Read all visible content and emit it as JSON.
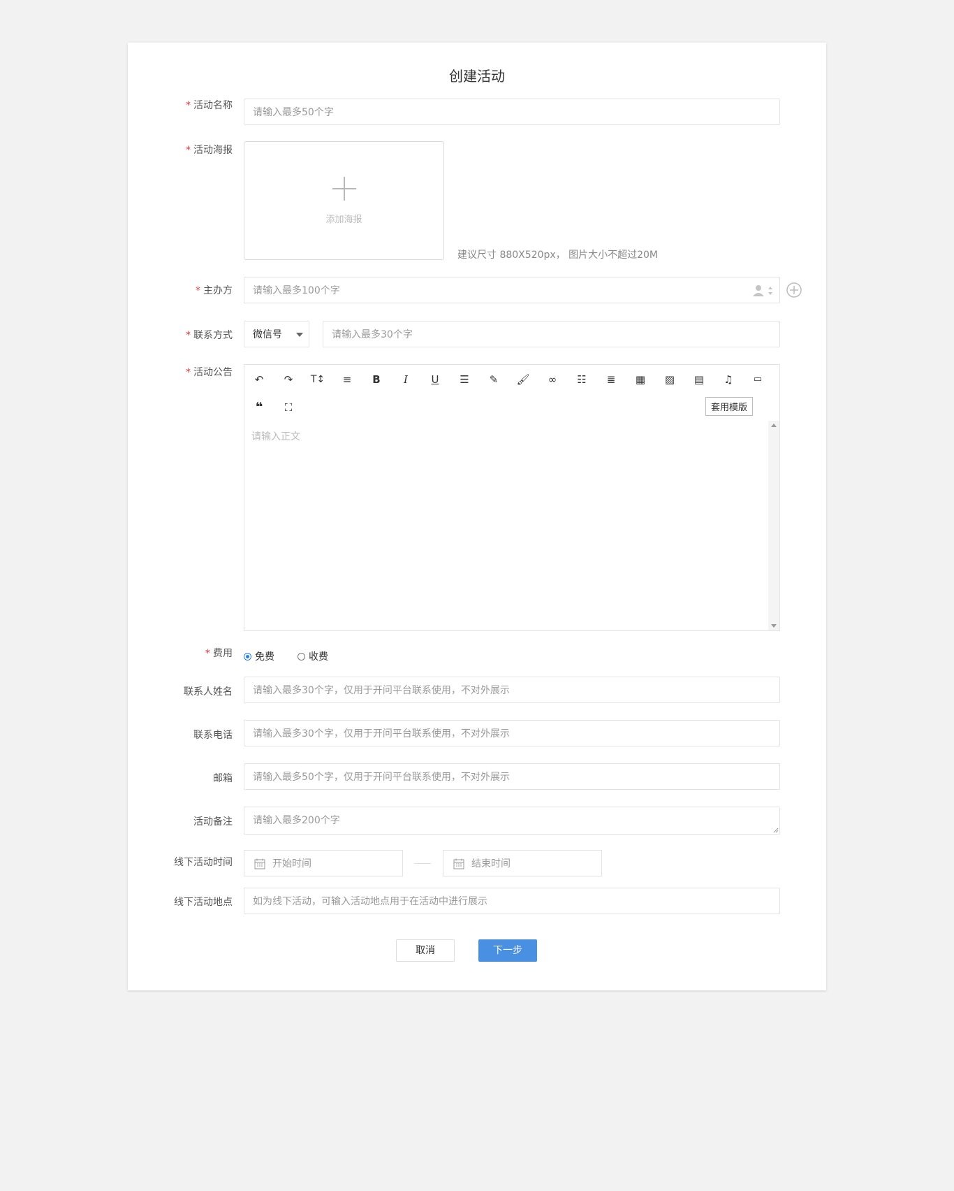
{
  "page": {
    "title": "创建活动"
  },
  "form": {
    "name": {
      "label": "活动名称",
      "placeholder": "请输入最多50个字"
    },
    "poster": {
      "label": "活动海报",
      "upload_text": "添加海报",
      "hint": "建议尺寸 880X520px， 图片大小不超过20M"
    },
    "organizer": {
      "label": "主办方",
      "placeholder": "请输入最多100个字"
    },
    "contact": {
      "label": "联系方式",
      "type_selected": "微信号",
      "placeholder": "请输入最多30个字"
    },
    "notice": {
      "label": "活动公告",
      "template_button": "套用模版",
      "placeholder": "请输入正文"
    },
    "fee": {
      "label": "费用",
      "options": [
        "免费",
        "收费"
      ],
      "selected": "免费"
    },
    "contact_name": {
      "label": "联系人姓名",
      "placeholder": "请输入最多30个字，仅用于开问平台联系使用，不对外展示"
    },
    "phone": {
      "label": "联系电话",
      "placeholder": "请输入最多30个字，仅用于开问平台联系使用，不对外展示"
    },
    "email": {
      "label": "邮箱",
      "placeholder": "请输入最多50个字，仅用于开问平台联系使用，不对外展示"
    },
    "remark": {
      "label": "活动备注",
      "placeholder": "请输入最多200个字"
    },
    "offline_time": {
      "label": "线下活动时间",
      "start_placeholder": "开始时间",
      "end_placeholder": "结束时间"
    },
    "offline_place": {
      "label": "线下活动地点",
      "placeholder": "如为线下活动，可输入活动地点用于在活动中进行展示"
    }
  },
  "actions": {
    "cancel": "取消",
    "next": "下一步"
  },
  "colors": {
    "primary": "#4a90e2",
    "required": "#e6393d"
  }
}
